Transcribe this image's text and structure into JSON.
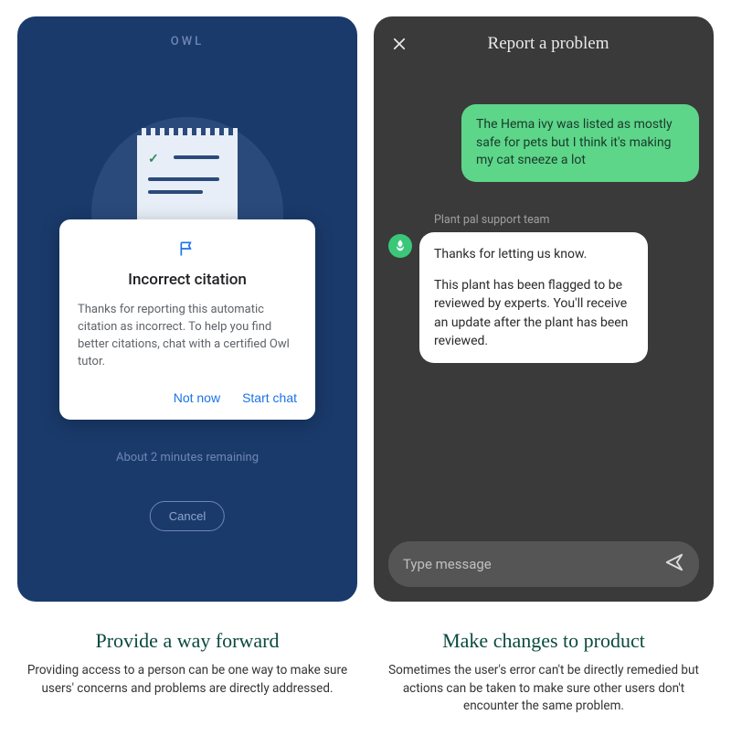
{
  "left": {
    "app_name": "OWL",
    "dialog": {
      "title": "Incorrect citation",
      "body": "Thanks for reporting this automatic citation as incorrect. To help you find better citations, chat with a certified Owl tutor.",
      "not_now": "Not now",
      "start_chat": "Start chat"
    },
    "remaining": "About 2 minutes remaining",
    "cancel": "Cancel"
  },
  "right": {
    "title": "Report a problem",
    "user_msg": "The Hema ivy was listed as mostly safe for pets but I think it's making my cat sneeze a lot",
    "team_label": "Plant pal support team",
    "agent_msg_1": "Thanks for letting us know.",
    "agent_msg_2": "This plant has been flagged to be reviewed by experts. You'll receive an update after the plant has been reviewed.",
    "input_placeholder": "Type message"
  },
  "captions": {
    "left_title": "Provide a way forward",
    "left_body": "Providing access to a person can be one way to make sure users' concerns and problems are directly addressed.",
    "right_title": "Make changes to product",
    "right_body": "Sometimes the user's error can't be directly remedied but actions can be taken to make sure other users don't encounter the same problem."
  }
}
